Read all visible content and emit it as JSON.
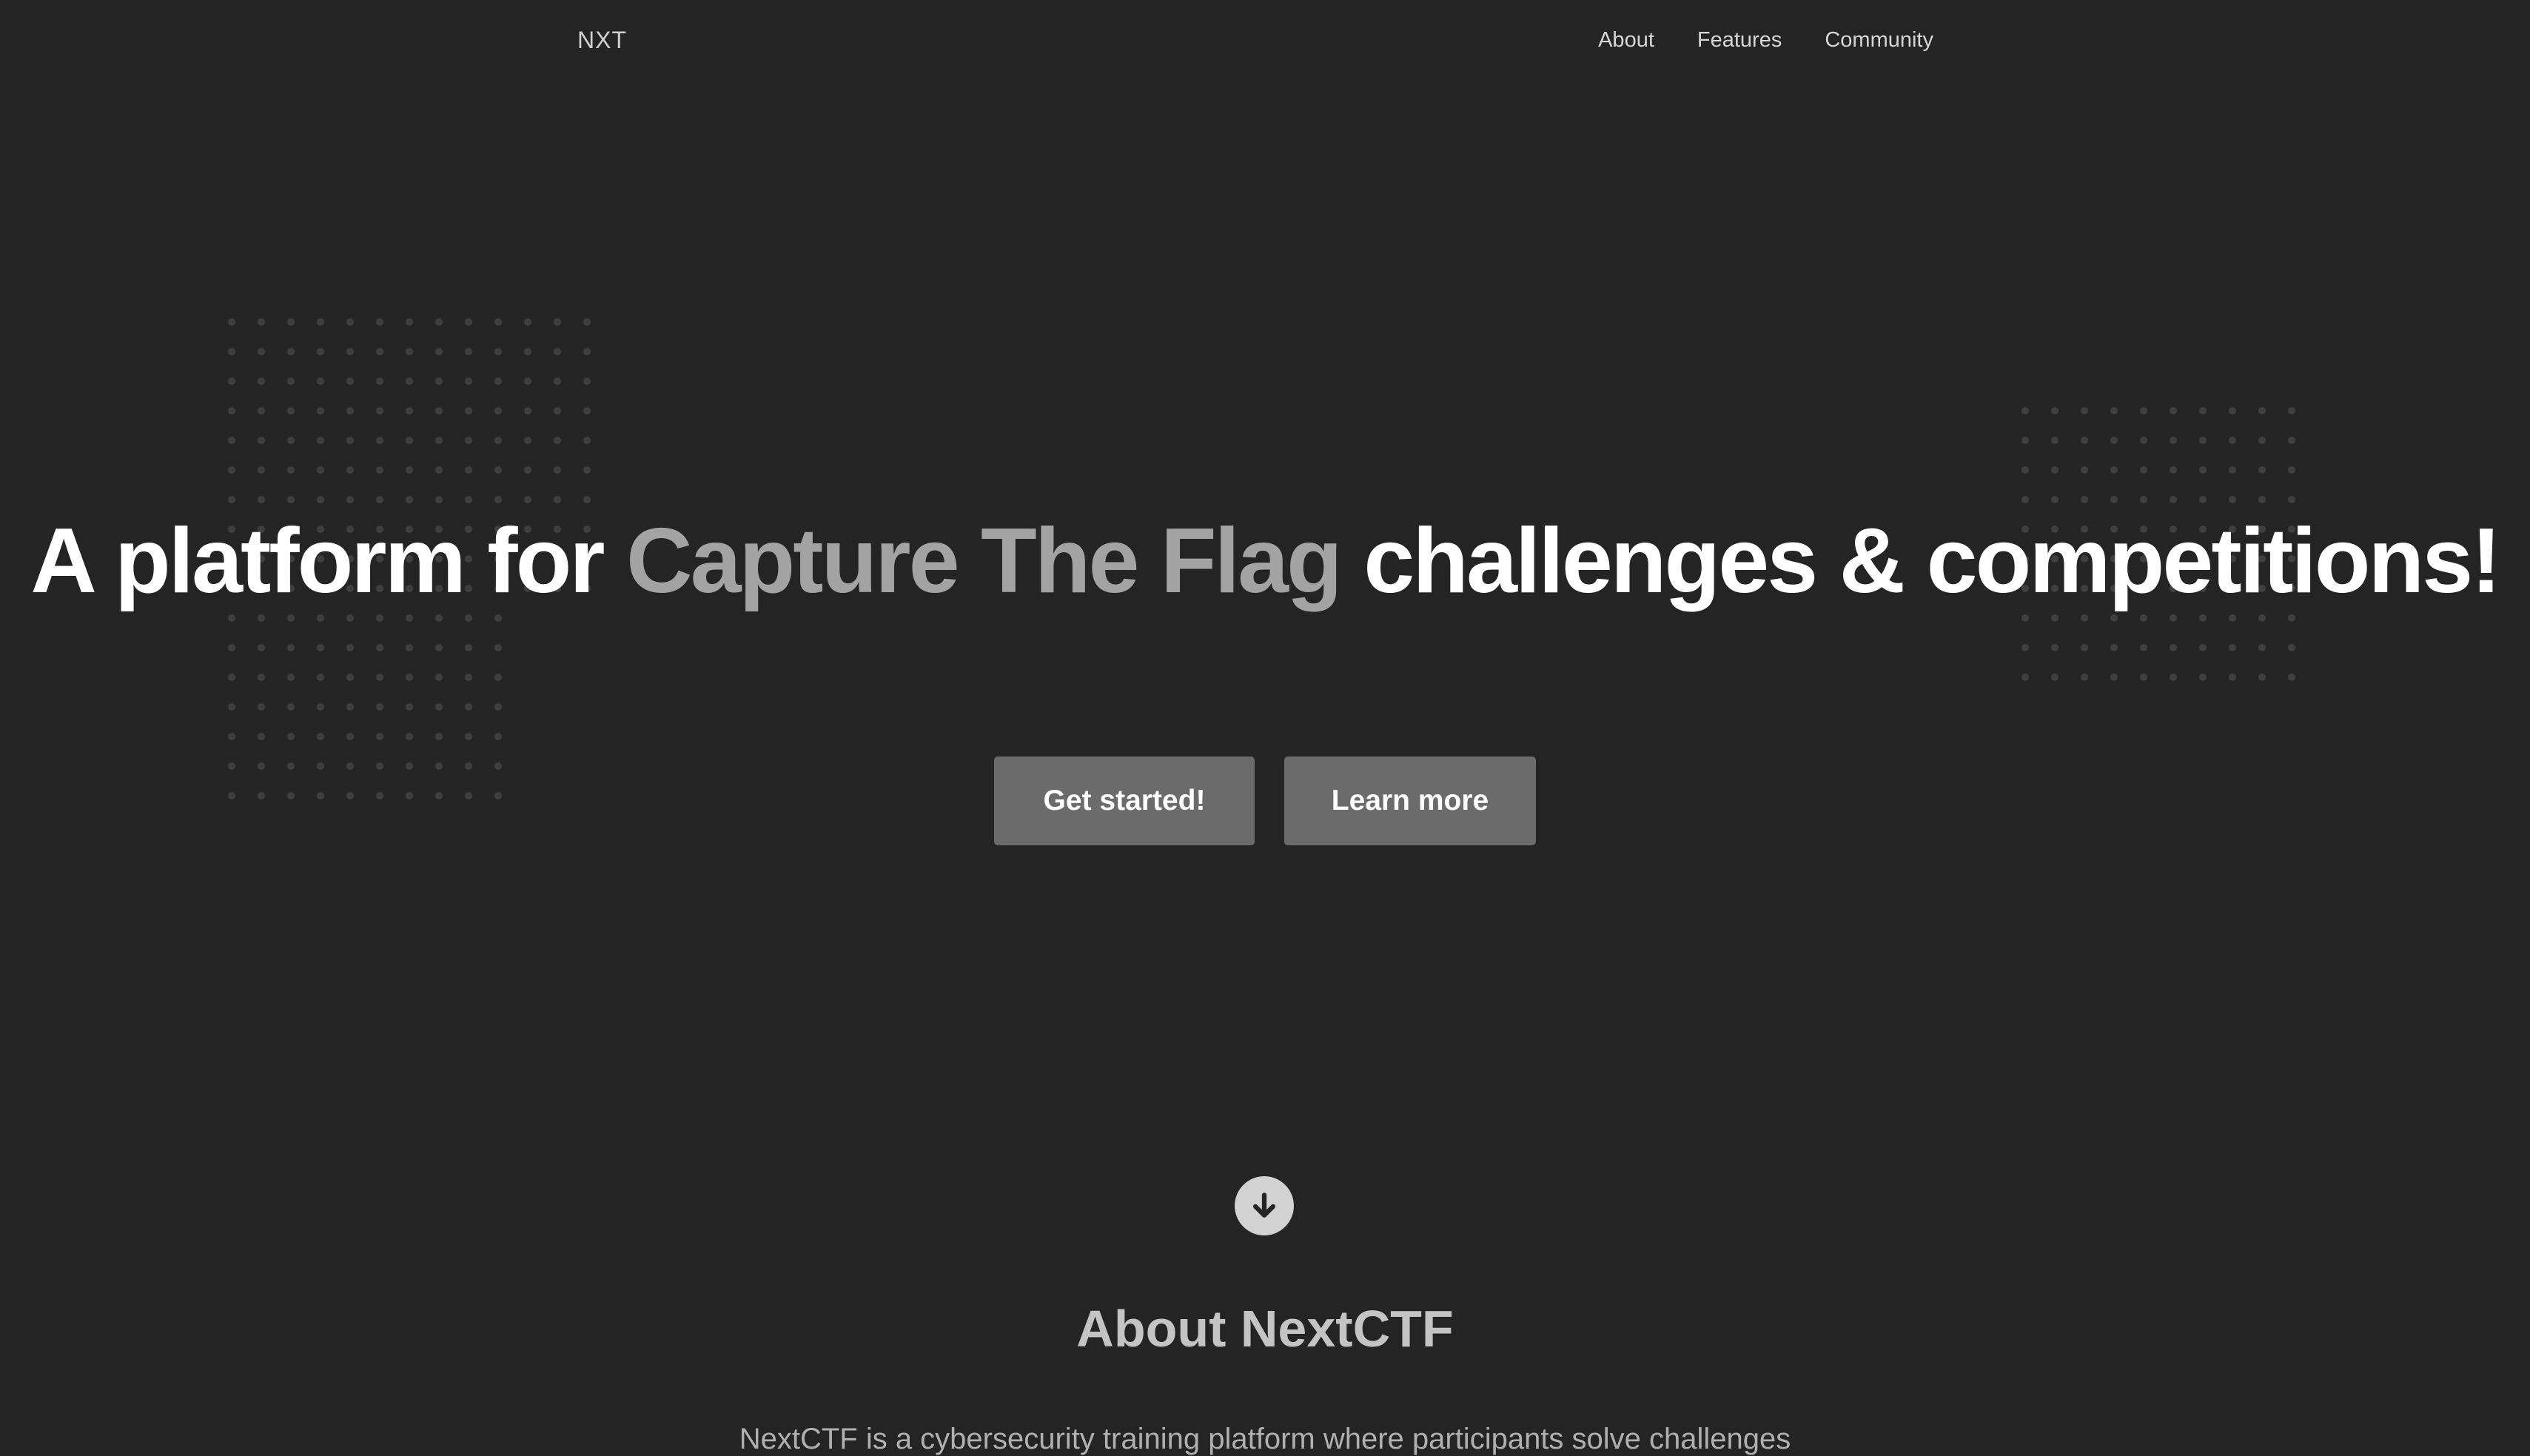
{
  "nav": {
    "logo": "NXT",
    "links": [
      "About",
      "Features",
      "Community"
    ]
  },
  "hero": {
    "title_part1": "A platform for ",
    "title_highlight": "Capture The Flag",
    "title_part2": " challenges & competitions!",
    "buttons": {
      "primary": "Get started!",
      "secondary": "Learn more"
    }
  },
  "scroll": {
    "icon": "arrow-down-circle-icon"
  },
  "about": {
    "title": "About NextCTF",
    "text": "NextCTF is a cybersecurity training platform where participants solve challenges"
  },
  "colors": {
    "background": "#242424",
    "button": "#6b6b6b",
    "highlight": "#a3a3a3",
    "dots": "#3f3f3f"
  }
}
